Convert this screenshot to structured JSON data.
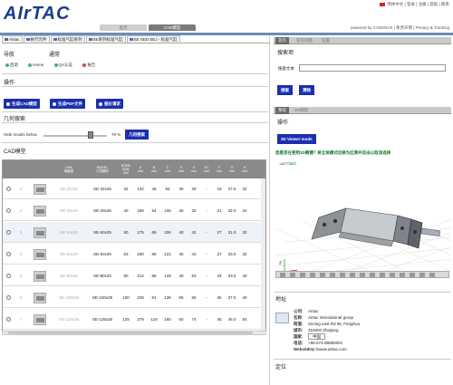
{
  "header": {
    "logo_text": "AIrTAC",
    "top_links": "简体中文 | 登录 | 注册 | 帮助 | 联系",
    "nav_tabs": [
      {
        "label": "首页",
        "active": false
      },
      {
        "label": "CAD模型",
        "active": true
      }
    ],
    "powered_by": "powered by CADENAS | 免责声明 | Privacy & Tracking"
  },
  "left": {
    "tabs": [
      "Airtac",
      "执行元件",
      "标准气缸系列",
      "SE系列标准气缸",
      "SE SED SEJ - 标准气缸"
    ],
    "nav_heading": "导航",
    "general_heading": "通常",
    "nav_items": [
      "后退",
      "Home",
      "QA认证",
      "报告"
    ],
    "action_heading": "操作",
    "action_buttons": [
      "生成CAD模型",
      "生成PDF文件",
      "报价请求"
    ],
    "geometry_heading": "几何搜索",
    "hide_label": "Hide results below",
    "hide_value": "70 %",
    "slider_fraction": 0.7,
    "geometry_button": "几何搜索",
    "cad_heading": "CAD模型",
    "table": {
      "headers": [
        "",
        "",
        "",
        "LINA\n明细表",
        "MODEL\n订货编号",
        "BORE\n缸径\nmm",
        "A\nmm",
        "B\nmm",
        "C\nmm",
        "D\nmm",
        "E\nmm",
        "E1\nmm",
        "F\nmm",
        "G\nmm",
        "H\nmm"
      ],
      "rows": [
        {
          "n": "1",
          "lina": "SE-32x25",
          "model": "SE-32x25",
          "bore": "32",
          "a": "142",
          "b": "48",
          "c": "94",
          "d": "30",
          "e": "29",
          "e1": "-",
          "f": "19",
          "g": "27.5",
          "h": "22"
        },
        {
          "n": "2",
          "lina": "SE-40x25",
          "model": "SE-40x25",
          "bore": "40",
          "a": "159",
          "b": "54",
          "c": "105",
          "d": "35",
          "e": "33",
          "e1": "-",
          "f": "21",
          "g": "32.0",
          "h": "24"
        },
        {
          "n": "3",
          "lina": "SE-50x25",
          "model": "SE-50x25",
          "bore": "50",
          "a": "175",
          "b": "69",
          "c": "106",
          "d": "40",
          "e": "42",
          "e1": "-",
          "f": "27",
          "g": "31.0",
          "h": "32"
        },
        {
          "n": "4",
          "lina": "SE-63x25",
          "model": "SE-63x25",
          "bore": "63",
          "a": "190",
          "b": "69",
          "c": "121",
          "d": "45",
          "e": "42",
          "e1": "-",
          "f": "27",
          "g": "33.0",
          "h": "32"
        },
        {
          "n": "5",
          "lina": "SE-80x25",
          "model": "SE-80x25",
          "bore": "80",
          "a": "214",
          "b": "86",
          "c": "128",
          "d": "45",
          "e": "53",
          "e1": "-",
          "f": "33",
          "g": "33.0",
          "h": "40"
        },
        {
          "n": "6",
          "lina": "SE-100x25",
          "model": "SE-100x25",
          "bore": "100",
          "a": "229",
          "b": "91",
          "c": "138",
          "d": "55",
          "e": "55",
          "e1": "-",
          "f": "36",
          "g": "37.0",
          "h": "40"
        },
        {
          "n": "7",
          "lina": "SE-125x25",
          "model": "SE-125x25",
          "bore": "125",
          "a": "279",
          "b": "119",
          "c": "160",
          "d": "60",
          "e": "74",
          "e1": "-",
          "f": "45",
          "g": "46.0",
          "h": "54"
        }
      ]
    }
  },
  "right": {
    "panel1_tabs": [
      "首页",
      "常见问题",
      "设置"
    ],
    "search_heading": "搜索项",
    "search_label": "搜索文本",
    "search_value": "",
    "search_buttons": [
      "搜索",
      "清除"
    ],
    "panel2_tabs": [
      "预览",
      "3D视图"
    ],
    "op_heading": "操作",
    "viewer_button": "3D Viewer mode",
    "note": "您是否在使用3D眼镜？将立体模式切换为红青并双击以取消选择",
    "address_heading": "地址",
    "address_rows": [
      {
        "label": "公司:",
        "value": "Airtac"
      },
      {
        "label": "名称:",
        "value": "Airtac international group"
      },
      {
        "label": "街道:",
        "value": "Siming east Rd 65, Fenghua"
      },
      {
        "label": "城市:",
        "value": "315500 Zhejiang"
      },
      {
        "label": "国家:",
        "value": "中国"
      },
      {
        "label": "电话:",
        "value": "+86-574-88950001"
      },
      {
        "label": "Website:",
        "value": "http://www.airtac.com"
      }
    ],
    "location_heading": "定位"
  },
  "colors": {
    "brand": "#1a3a8c",
    "button": "#1b2fb0",
    "note": "#0a7a2a"
  }
}
